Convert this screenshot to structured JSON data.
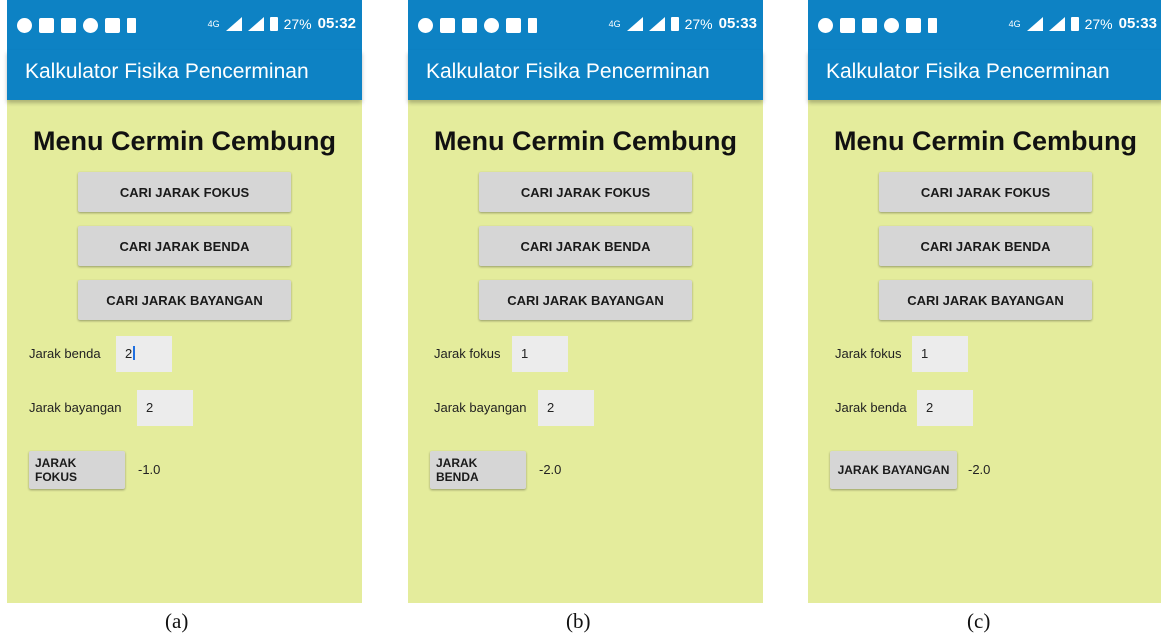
{
  "status_bar": [
    {
      "time": "05:32",
      "battery": "27%",
      "network": "4G"
    },
    {
      "time": "05:33",
      "battery": "27%",
      "network": "4G"
    },
    {
      "time": "05:33",
      "battery": "27%",
      "network": "4G"
    }
  ],
  "app_title": "Kalkulator Fisika Pencerminan",
  "menu_title": "Menu Cermin Cembung",
  "buttons": {
    "focus": "CARI JARAK FOKUS",
    "object": "CARI JARAK BENDA",
    "image": "CARI JARAK BAYANGAN"
  },
  "screens": [
    {
      "caption": "(a)",
      "field1_label": "Jarak benda",
      "field1_value": "2",
      "field2_label": "Jarak bayangan",
      "field2_value": "2",
      "action": "JARAK FOKUS",
      "result": "-1.0"
    },
    {
      "caption": "(b)",
      "field1_label": "Jarak fokus",
      "field1_value": "1",
      "field2_label": "Jarak bayangan",
      "field2_value": "2",
      "action": "JARAK BENDA",
      "result": "-2.0"
    },
    {
      "caption": "(c)",
      "field1_label": "Jarak fokus",
      "field1_value": "1",
      "field2_label": "Jarak benda",
      "field2_value": "2",
      "action": "JARAK BAYANGAN",
      "result": "-2.0"
    }
  ],
  "colors": {
    "app_bar": "#0d82c4",
    "background": "#e4ec9c",
    "button": "#d6d6d6"
  }
}
